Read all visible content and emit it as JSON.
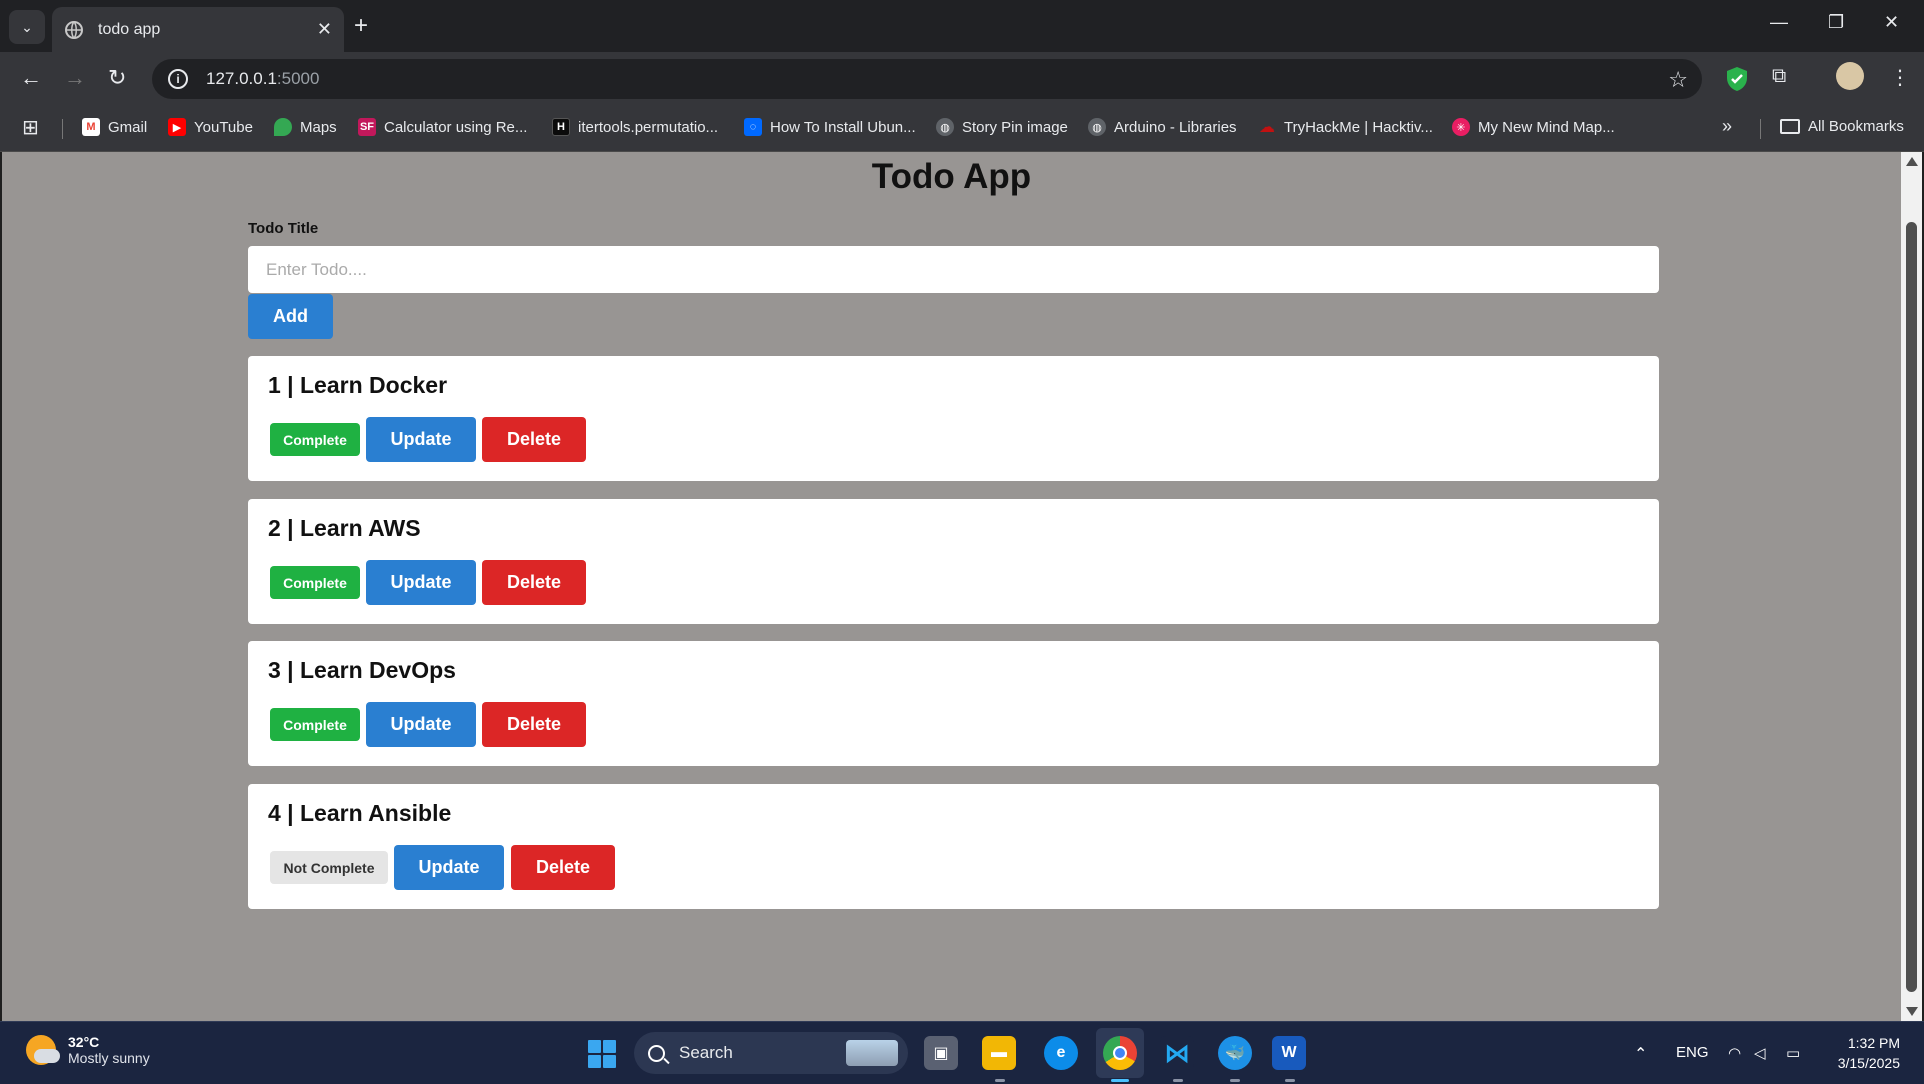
{
  "browser": {
    "tab_title": "todo app",
    "url_host": "127.0.0.1",
    "url_port": ":5000",
    "bookmarks": [
      {
        "label": "Gmail",
        "icon": "gmail-icon",
        "color": "#ea4335"
      },
      {
        "label": "YouTube",
        "icon": "youtube-icon",
        "color": "#ff0000"
      },
      {
        "label": "Maps",
        "icon": "maps-icon",
        "color": "#34a853"
      },
      {
        "label": "Calculator using Re...",
        "icon": "sf-icon",
        "color": "#c2185b"
      },
      {
        "label": "itertools.permutatio...",
        "icon": "hr-icon",
        "color": "#0b0b0b"
      },
      {
        "label": "How To Install Ubun...",
        "icon": "digitalocean-icon",
        "color": "#0069ff"
      },
      {
        "label": "Story Pin image",
        "icon": "globe-icon",
        "color": "#9aa0a6"
      },
      {
        "label": "Arduino - Libraries",
        "icon": "globe-icon",
        "color": "#9aa0a6"
      },
      {
        "label": "TryHackMe | Hacktiv...",
        "icon": "tryhackme-icon",
        "color": "#c11111"
      },
      {
        "label": "My New Mind Map...",
        "icon": "mindmap-icon",
        "color": "#e91e63"
      }
    ],
    "all_bookmarks": "All Bookmarks"
  },
  "app": {
    "title": "Todo App",
    "field_label": "Todo Title",
    "input_placeholder": "Enter Todo....",
    "add_label": "Add",
    "todos": [
      {
        "title": "1 | Learn Docker",
        "status": "Complete",
        "done": true
      },
      {
        "title": "2 | Learn AWS",
        "status": "Complete",
        "done": true
      },
      {
        "title": "3 | Learn DevOps",
        "status": "Complete",
        "done": true
      },
      {
        "title": "4 | Learn Ansible",
        "status": "Not Complete",
        "done": false
      }
    ],
    "update_label": "Update",
    "delete_label": "Delete",
    "colors": {
      "update": "#2a7fd1",
      "delete": "#dc2626",
      "complete": "#1fb142",
      "not_complete": "#e5e5e5",
      "background": "#989593"
    }
  },
  "taskbar": {
    "temp": "32°C",
    "condition": "Mostly sunny",
    "search_label": "Search",
    "language": "ENG",
    "time": "1:32 PM",
    "date": "3/15/2025"
  }
}
